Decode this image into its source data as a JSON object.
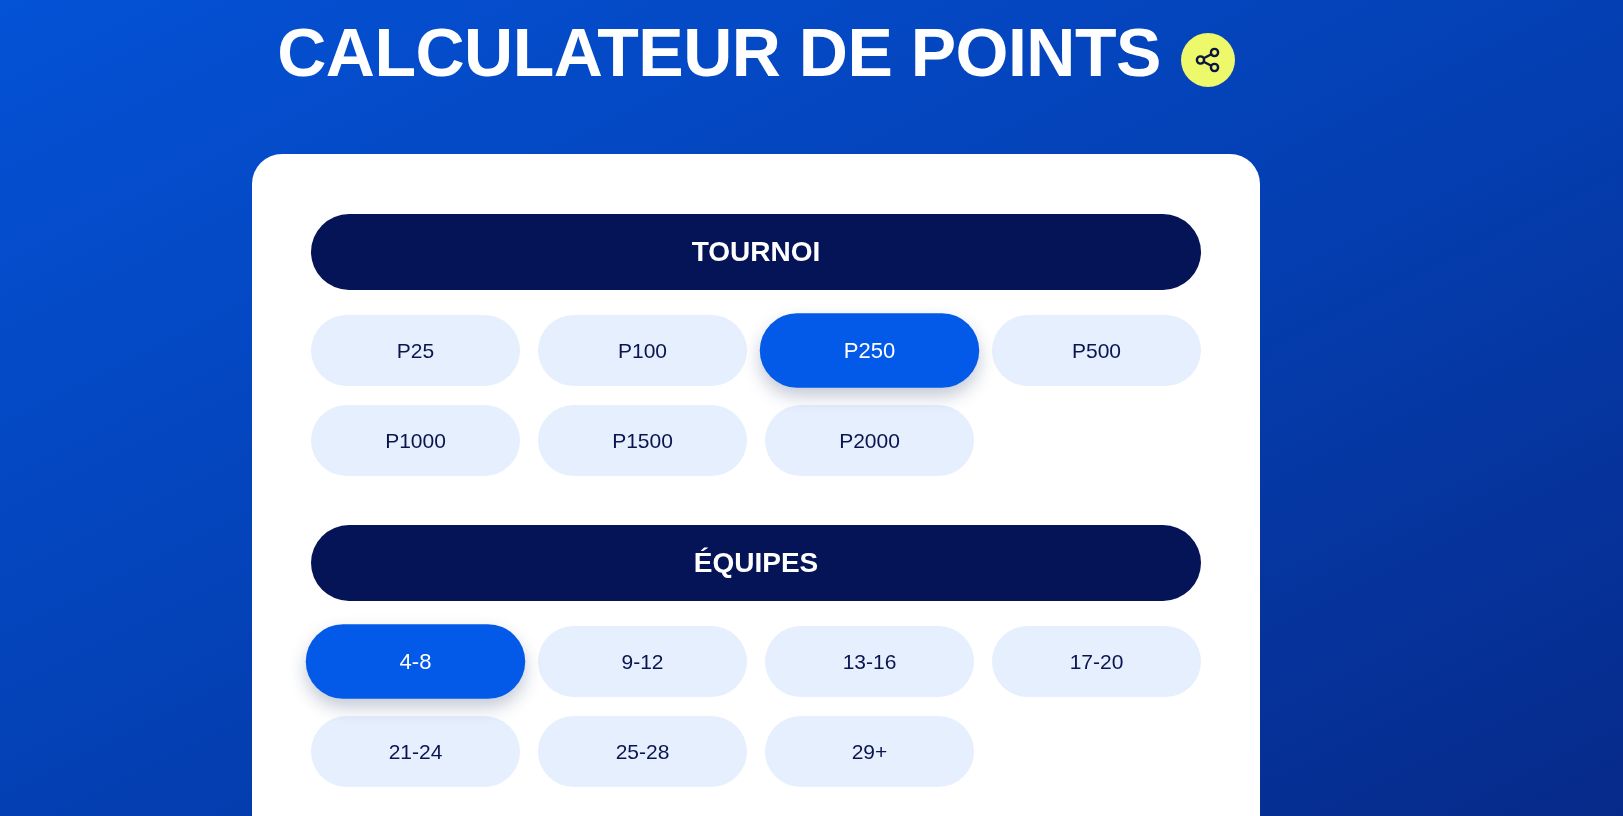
{
  "title": "CALCULATEUR DE POINTS",
  "sections": [
    {
      "heading": "TOURNOI",
      "options": [
        {
          "label": "P25",
          "selected": false
        },
        {
          "label": "P100",
          "selected": false
        },
        {
          "label": "P250",
          "selected": true
        },
        {
          "label": "P500",
          "selected": false
        },
        {
          "label": "P1000",
          "selected": false
        },
        {
          "label": "P1500",
          "selected": false
        },
        {
          "label": "P2000",
          "selected": false
        }
      ]
    },
    {
      "heading": "ÉQUIPES",
      "options": [
        {
          "label": "4-8",
          "selected": true
        },
        {
          "label": "9-12",
          "selected": false
        },
        {
          "label": "13-16",
          "selected": false
        },
        {
          "label": "17-20",
          "selected": false
        },
        {
          "label": "21-24",
          "selected": false
        },
        {
          "label": "25-28",
          "selected": false
        },
        {
          "label": "29+",
          "selected": false
        }
      ]
    }
  ]
}
